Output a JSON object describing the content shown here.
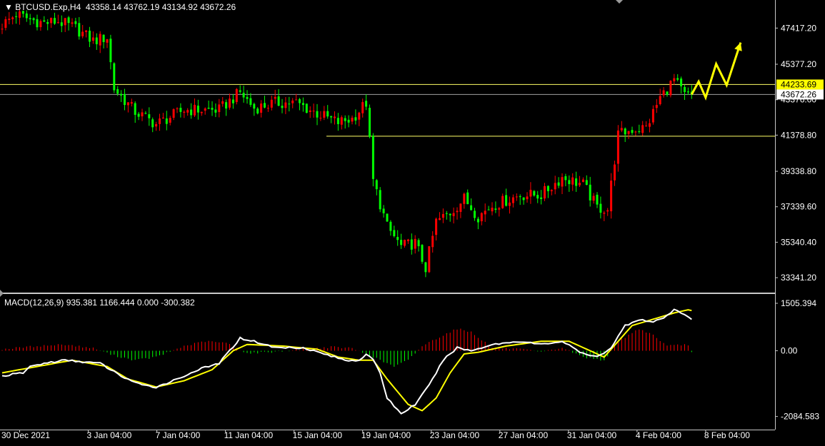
{
  "header": {
    "symbol": "BTCUSD.Exp,H4",
    "ohlc": "43358.14 43762.19 43134.92 43672.26"
  },
  "macd": {
    "label": "MACD(12,26,9) 935.381 1166.444 0.000 -300.382"
  },
  "colors": {
    "bull": "#ff0000",
    "bear": "#00ff00",
    "macd_line": "#ffffff",
    "signal_line": "#ffff00",
    "hline": "#ffff66",
    "price_tag_bg": "#ffff00",
    "grid": "#c0c0c0"
  },
  "chart_data": [
    {
      "type": "candlestick",
      "symbol": "BTCUSD.Exp",
      "timeframe": "H4",
      "ylim": [
        32500,
        49000
      ],
      "y_ticks": [
        "47417.20",
        "45377.20",
        "43376.00",
        "41378.80",
        "39338.80",
        "37339.60",
        "35340.40",
        "33341.20"
      ],
      "x_ticks": [
        "30 Dec 2021",
        "3 Jan 04:00",
        "7 Jan 04:00",
        "11 Jan 04:00",
        "15 Jan 04:00",
        "19 Jan 04:00",
        "23 Jan 04:00",
        "27 Jan 04:00",
        "31 Jan 04:00",
        "4 Feb 04:00",
        "8 Feb 04:00"
      ],
      "price_labels": {
        "resistance": "44233.69",
        "current": "43672.26"
      },
      "levels": {
        "resistance": 44233.69,
        "current": 43672.26,
        "support": 41320
      },
      "close_path": [
        [
          0,
          47600
        ],
        [
          4,
          48200
        ],
        [
          8,
          47900
        ],
        [
          12,
          47700
        ],
        [
          16,
          47800
        ],
        [
          21,
          47400
        ],
        [
          26,
          46700
        ],
        [
          30,
          46900
        ],
        [
          32,
          44000
        ],
        [
          38,
          42700
        ],
        [
          44,
          42000
        ],
        [
          52,
          42800
        ],
        [
          62,
          42800
        ],
        [
          68,
          43800
        ],
        [
          72,
          42900
        ],
        [
          78,
          43200
        ],
        [
          84,
          43200
        ],
        [
          90,
          42600
        ],
        [
          96,
          42100
        ],
        [
          100,
          42300
        ],
        [
          104,
          43200
        ],
        [
          106,
          38800
        ],
        [
          110,
          36200
        ],
        [
          114,
          35100
        ],
        [
          118,
          35300
        ],
        [
          121,
          33900
        ],
        [
          124,
          36500
        ],
        [
          128,
          37000
        ],
        [
          132,
          37800
        ],
        [
          136,
          36800
        ],
        [
          140,
          37400
        ],
        [
          144,
          37700
        ],
        [
          148,
          38000
        ],
        [
          154,
          38000
        ],
        [
          160,
          39000
        ],
        [
          166,
          38600
        ],
        [
          170,
          37300
        ],
        [
          173,
          37200
        ],
        [
          176,
          41400
        ],
        [
          180,
          41700
        ],
        [
          184,
          41800
        ],
        [
          188,
          43500
        ],
        [
          192,
          44500
        ],
        [
          195,
          43600
        ],
        [
          197,
          43672
        ]
      ],
      "forecast_arrow": [
        [
          197,
          43672
        ],
        [
          199,
          44400
        ],
        [
          201,
          43500
        ],
        [
          204,
          45400
        ],
        [
          207,
          44200
        ],
        [
          211,
          46600
        ]
      ]
    },
    {
      "type": "macd",
      "params": "MACD(12,26,9)",
      "ylim": [
        -2500,
        1800
      ],
      "y_ticks": [
        "1505.394",
        "0.00",
        "-2084.583"
      ],
      "macd_path": [
        [
          0,
          -800
        ],
        [
          6,
          -700
        ],
        [
          8,
          -500
        ],
        [
          12,
          -400
        ],
        [
          18,
          -300
        ],
        [
          28,
          -400
        ],
        [
          34,
          -800
        ],
        [
          40,
          -1100
        ],
        [
          44,
          -1150
        ],
        [
          50,
          -900
        ],
        [
          56,
          -600
        ],
        [
          62,
          -400
        ],
        [
          68,
          400
        ],
        [
          72,
          300
        ],
        [
          78,
          100
        ],
        [
          86,
          100
        ],
        [
          92,
          -100
        ],
        [
          98,
          -300
        ],
        [
          102,
          -300
        ],
        [
          104,
          -100
        ],
        [
          106,
          -300
        ],
        [
          108,
          -700
        ],
        [
          110,
          -1500
        ],
        [
          114,
          -2000
        ],
        [
          118,
          -1700
        ],
        [
          122,
          -1100
        ],
        [
          126,
          -300
        ],
        [
          130,
          100
        ],
        [
          134,
          0
        ],
        [
          140,
          200
        ],
        [
          148,
          300
        ],
        [
          154,
          200
        ],
        [
          160,
          300
        ],
        [
          166,
          -100
        ],
        [
          170,
          -200
        ],
        [
          174,
          100
        ],
        [
          178,
          800
        ],
        [
          182,
          1000
        ],
        [
          186,
          900
        ],
        [
          190,
          1100
        ],
        [
          192,
          1300
        ],
        [
          196,
          1100
        ],
        [
          198,
          900
        ]
      ],
      "signal_path": [
        [
          0,
          -700
        ],
        [
          10,
          -500
        ],
        [
          20,
          -300
        ],
        [
          30,
          -500
        ],
        [
          36,
          -900
        ],
        [
          44,
          -1150
        ],
        [
          52,
          -950
        ],
        [
          60,
          -600
        ],
        [
          66,
          0
        ],
        [
          70,
          200
        ],
        [
          80,
          150
        ],
        [
          90,
          50
        ],
        [
          96,
          -200
        ],
        [
          102,
          -300
        ],
        [
          106,
          -300
        ],
        [
          110,
          -900
        ],
        [
          116,
          -1700
        ],
        [
          120,
          -1900
        ],
        [
          124,
          -1500
        ],
        [
          128,
          -700
        ],
        [
          132,
          -100
        ],
        [
          136,
          -50
        ],
        [
          144,
          150
        ],
        [
          154,
          300
        ],
        [
          162,
          300
        ],
        [
          168,
          0
        ],
        [
          172,
          -200
        ],
        [
          176,
          300
        ],
        [
          180,
          800
        ],
        [
          186,
          1000
        ],
        [
          192,
          1200
        ],
        [
          196,
          1300
        ],
        [
          198,
          1250
        ]
      ],
      "histogram_path": [
        [
          0,
          50
        ],
        [
          10,
          150
        ],
        [
          18,
          200
        ],
        [
          26,
          80
        ],
        [
          32,
          -150
        ],
        [
          38,
          -300
        ],
        [
          44,
          -200
        ],
        [
          52,
          150
        ],
        [
          58,
          300
        ],
        [
          64,
          250
        ],
        [
          70,
          -80
        ],
        [
          78,
          -30
        ],
        [
          86,
          50
        ],
        [
          94,
          120
        ],
        [
          100,
          80
        ],
        [
          106,
          -200
        ],
        [
          112,
          -500
        ],
        [
          116,
          -300
        ],
        [
          120,
          150
        ],
        [
          126,
          500
        ],
        [
          130,
          700
        ],
        [
          134,
          600
        ],
        [
          140,
          100
        ],
        [
          148,
          50
        ],
        [
          154,
          -50
        ],
        [
          160,
          100
        ],
        [
          166,
          -200
        ],
        [
          172,
          -300
        ],
        [
          176,
          300
        ],
        [
          182,
          700
        ],
        [
          186,
          500
        ],
        [
          190,
          150
        ],
        [
          196,
          200
        ],
        [
          198,
          -300
        ]
      ]
    }
  ]
}
